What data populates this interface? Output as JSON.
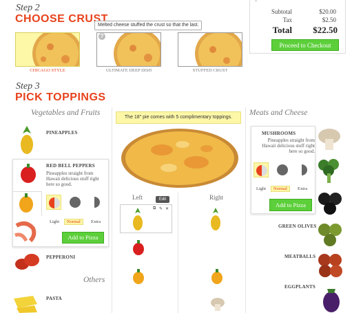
{
  "step2": {
    "label": "Step 2",
    "title": "CHOOSE CRUST"
  },
  "summary": {
    "subtotal_label": "Subtotal",
    "subtotal_value": "$20.00",
    "tax_label": "Tax",
    "tax_value": "$2.50",
    "total_label": "Total",
    "total_value": "$22.50",
    "checkout_label": "Proceed to Checkout"
  },
  "crusts": [
    {
      "label": "CHICAGO STYLE",
      "selected": true
    },
    {
      "label": "ULTIMATE DEEP DISH",
      "selected": false
    },
    {
      "label": "STUFFED CRUST",
      "selected": false
    }
  ],
  "crust_tooltip": "Melted cheese stuffed the crust so that the last.",
  "step3": {
    "label": "Step 3",
    "title": "PICK TOPPINGS"
  },
  "columns": {
    "veg_head": "Vegetables and Fruits",
    "meat_head": "Meats and Cheese",
    "others_head": "Others"
  },
  "notice": "The 18\" pie comes with 5 complimentary toppings.",
  "veg_items": [
    {
      "name": "PINEAPPLES"
    },
    {
      "name": "RED BELL PEPPERS",
      "desc": "Pineapples straight from Hawaii delicious stuff right here so good."
    },
    {
      "name": "PEPPERONI"
    },
    {
      "name": "PASTA"
    }
  ],
  "veg_popup": {
    "light": "Light",
    "normal": "Normal",
    "extra": "Extra",
    "add": "Add to Pizza"
  },
  "meat_items": [
    {
      "name": "MUSHROOMS",
      "desc": "Pineapples straight from Hawaii delicious stuff right here so good."
    },
    {
      "name": "GREEN OLIVES"
    },
    {
      "name": "MEATBALLS"
    },
    {
      "name": "EGGPLANTS"
    }
  ],
  "meat_popup": {
    "light": "Light",
    "normal": "Normal",
    "extra": "Extra",
    "add": "Add to Pizza"
  },
  "placement": {
    "left": "Left",
    "right": "Right",
    "edit_tip": "Edit"
  },
  "colors": {
    "accent": "#e8421c",
    "button": "#5ccf3a",
    "highlight": "#fdf7a8"
  }
}
